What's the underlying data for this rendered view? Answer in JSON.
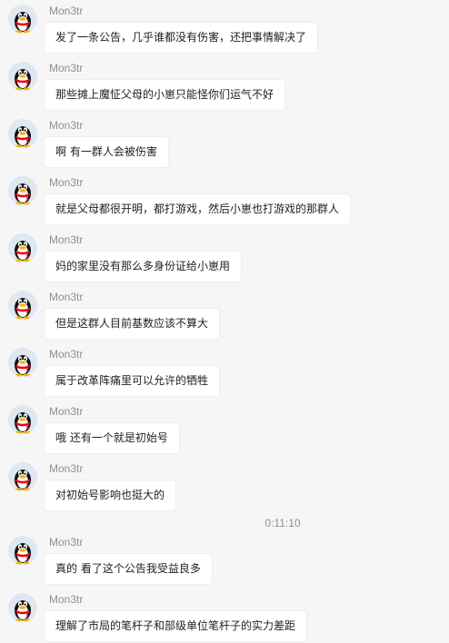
{
  "messages": [
    {
      "sender": "Mon3tr",
      "text": "发了一条公告，几乎谁都没有伤害，还把事情解决了"
    },
    {
      "sender": "Mon3tr",
      "text": "那些摊上魔怔父母的小崽只能怪你们运气不好"
    },
    {
      "sender": "Mon3tr",
      "text": "啊 有一群人会被伤害"
    },
    {
      "sender": "Mon3tr",
      "text": "就是父母都很开明，都打游戏，然后小崽也打游戏的那群人"
    },
    {
      "sender": "Mon3tr",
      "text": "妈的家里没有那么多身份证给小崽用"
    },
    {
      "sender": "Mon3tr",
      "text": "但是这群人目前基数应该不算大"
    },
    {
      "sender": "Mon3tr",
      "text": "属于改革阵痛里可以允许的牺牲"
    },
    {
      "sender": "Mon3tr",
      "text": "哦 还有一个就是初始号"
    },
    {
      "sender": "Mon3tr",
      "text": "对初始号影响也挺大的"
    },
    {
      "sender": "Mon3tr",
      "text": "真的 看了这个公告我受益良多"
    },
    {
      "sender": "Mon3tr",
      "text": "理解了市局的笔杆子和部级单位笔杆子的实力差距"
    }
  ],
  "timestamp": "0:11:10",
  "avatar_icon": "qq-penguin-icon",
  "colors": {
    "background": "#f6f6f6",
    "bubble": "#ffffff",
    "name_text": "#8f8f8f",
    "message_text": "#222222"
  }
}
